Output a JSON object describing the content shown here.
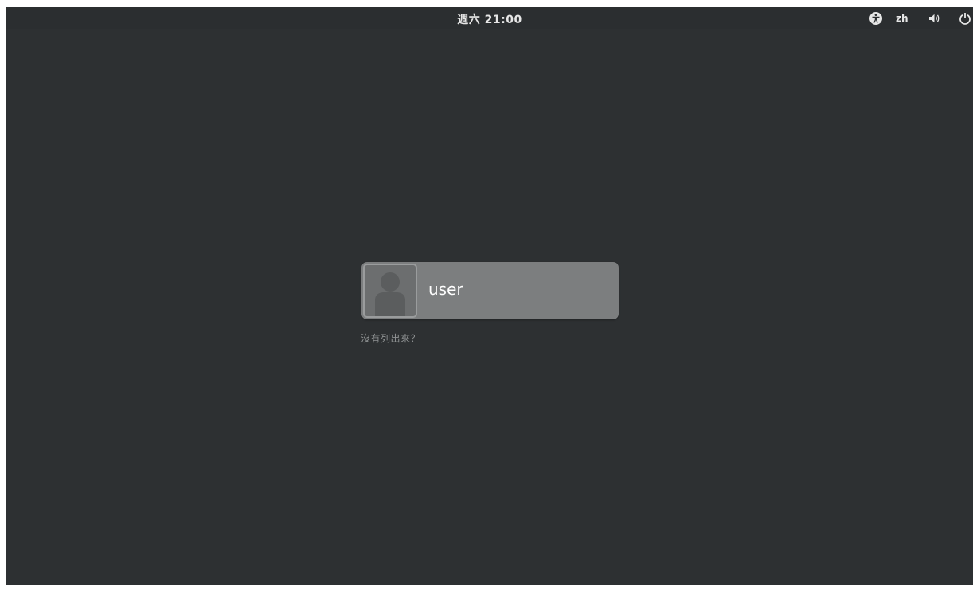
{
  "top_bar": {
    "clock": "週六 21:00",
    "language": "zh",
    "icons": [
      "accessibility-icon",
      "volume-icon",
      "power-icon"
    ]
  },
  "login": {
    "username": "user",
    "not_listed": "沒有列出來？"
  },
  "colors": {
    "background": "#2d3032",
    "card": "#7c7e7f",
    "text": "#ffffff",
    "muted_text": "#8f9293"
  }
}
